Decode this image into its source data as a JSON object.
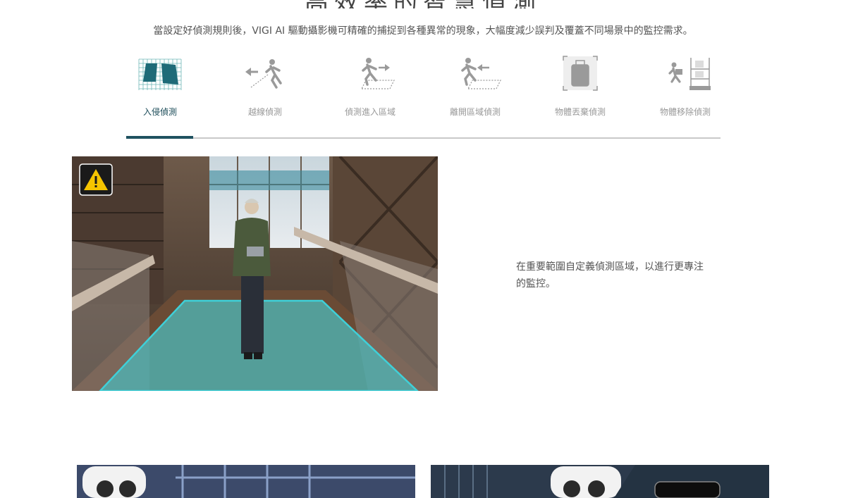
{
  "section": {
    "heading": "高效率的智慧偵測",
    "intro": "當設定好偵測規則後，VIGI AI 驅動攝影機可精確的捕捉到各種異常的現象，大幅度減少誤判及覆蓋不同場景中的監控需求。"
  },
  "tabs": [
    {
      "label": "入侵偵測",
      "icon": "intrusion-zone-icon",
      "active": true
    },
    {
      "label": "越線偵測",
      "icon": "line-crossing-icon",
      "active": false
    },
    {
      "label": "偵測進入區域",
      "icon": "region-entering-icon",
      "active": false
    },
    {
      "label": "離開區域偵測",
      "icon": "region-exiting-icon",
      "active": false
    },
    {
      "label": "物體丟棄偵測",
      "icon": "object-abandoned-icon",
      "active": false
    },
    {
      "label": "物體移除偵測",
      "icon": "object-removal-icon",
      "active": false
    }
  ],
  "panel": {
    "description": "在重要範圍自定義偵測區域，以進行更專注的監控。",
    "image_icon": "warning-icon"
  },
  "colors": {
    "accent": "#1f5260",
    "zone_fill": "#4fb3b3",
    "zone_outline": "#3fd0d8",
    "warning": "#f5c400",
    "inactive_icon": "#9a9a9a"
  }
}
